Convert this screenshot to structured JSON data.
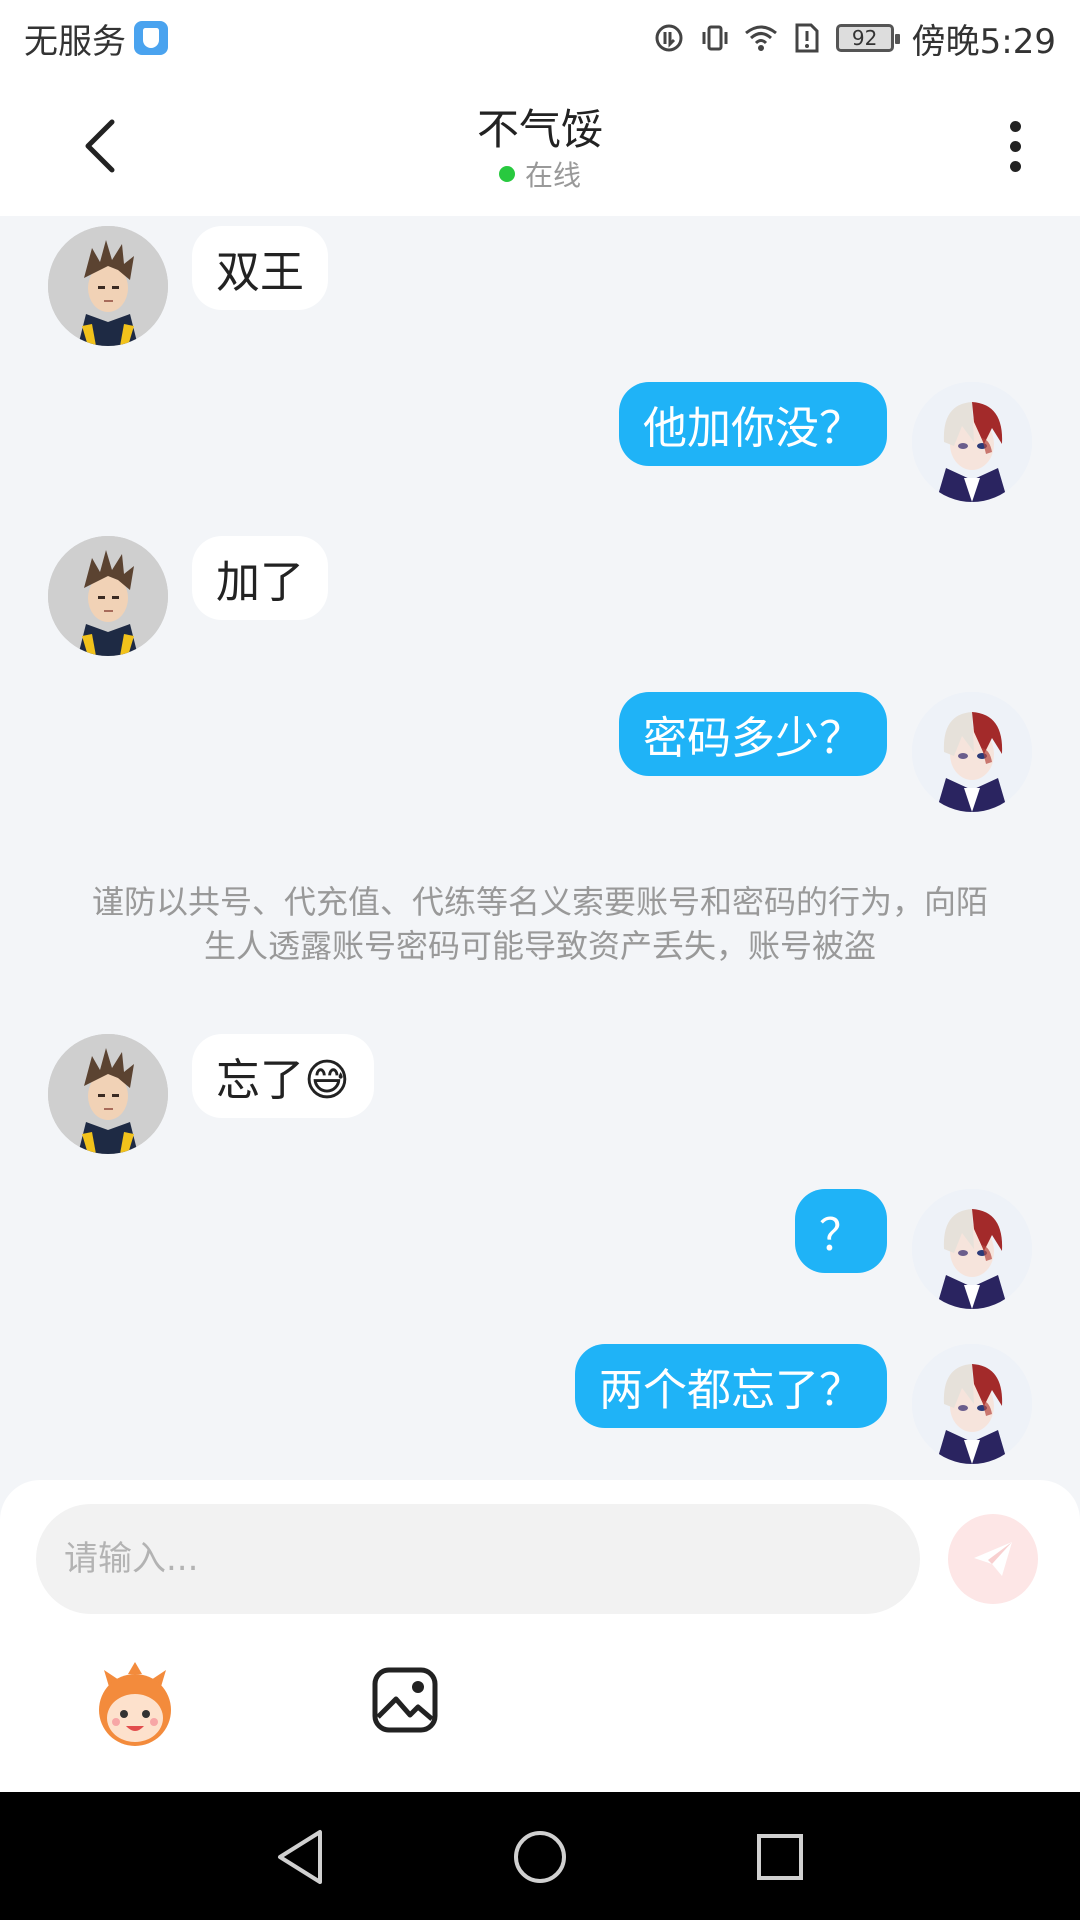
{
  "status_bar": {
    "carrier": "无服务",
    "battery": "92",
    "time": "傍晚5:29"
  },
  "header": {
    "title": "不气馁",
    "status": "在线"
  },
  "messages": [
    {
      "side": "left",
      "text": "双王"
    },
    {
      "side": "right",
      "text": "他加你没？"
    },
    {
      "side": "left",
      "text": "加了"
    },
    {
      "side": "right",
      "text": "密码多少？"
    },
    {
      "side": "left",
      "text": "忘了😅"
    },
    {
      "side": "right",
      "text": "？"
    },
    {
      "side": "right",
      "text": "两个都忘了？"
    }
  ],
  "notice": "谨防以共号、代充值、代练等名义索要账号和密码的行为，向陌生人透露账号密码可能导致资产丢失，账号被盗",
  "input": {
    "placeholder": "请输入..."
  },
  "colors": {
    "accent": "#1fb3f7",
    "online": "#28c93f",
    "send_button": "#fde6e6"
  },
  "icons": [
    "back-icon",
    "more-icon",
    "send-icon",
    "emoji-icon",
    "image-icon",
    "nav-back-icon",
    "nav-home-icon",
    "nav-recents-icon"
  ]
}
